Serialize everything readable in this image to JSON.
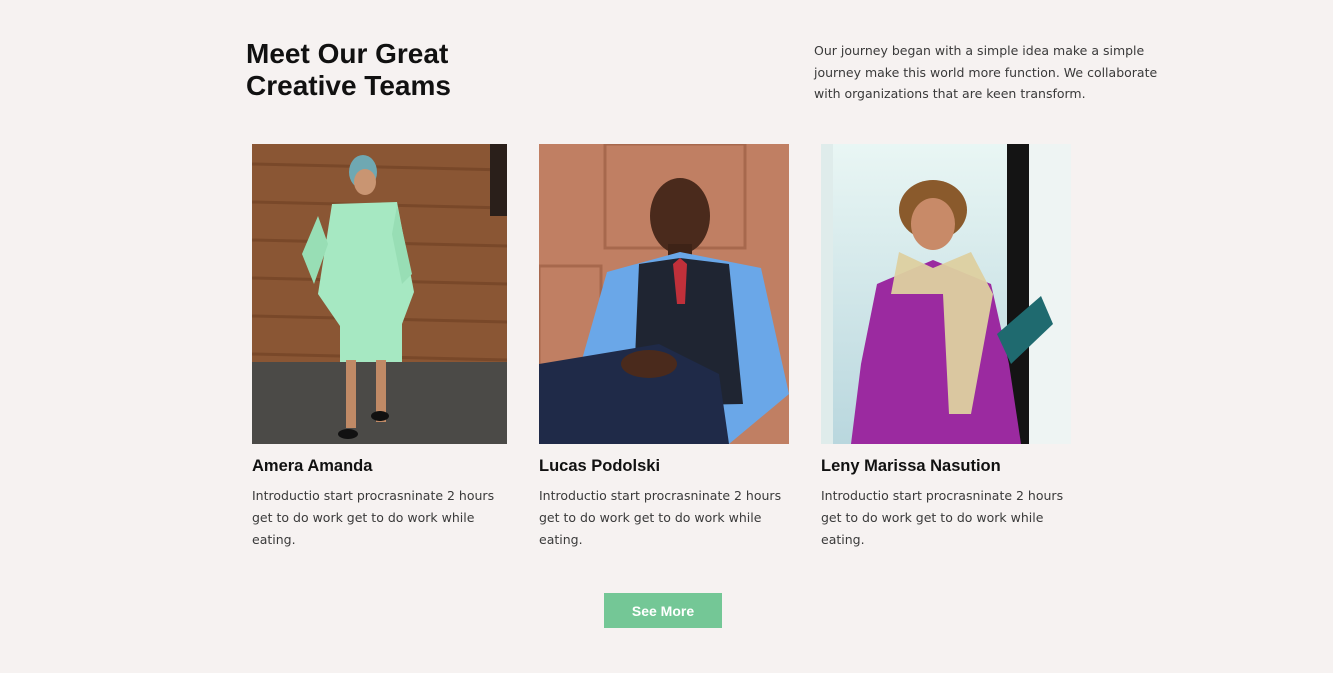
{
  "section": {
    "heading_line1": "Meet Our Great",
    "heading_line2": "Creative Teams",
    "intro": "Our journey began with a simple idea make a simple journey make this world more function. We collaborate with organizations that are keen transform."
  },
  "team": [
    {
      "name": "Amera Amanda",
      "description": "Introductio start procrasninate 2 hours get to do work get to do work while eating."
    },
    {
      "name": "Lucas Podolski",
      "description": "Introductio start procrasninate 2 hours get to do work get to do work while eating."
    },
    {
      "name": "Leny Marissa Nasution",
      "description": "Introductio start procrasninate 2 hours get to do work get to do work while eating."
    }
  ],
  "cta": {
    "label": "See More"
  },
  "colors": {
    "background": "#f6f2f1",
    "button": "#74c796"
  }
}
